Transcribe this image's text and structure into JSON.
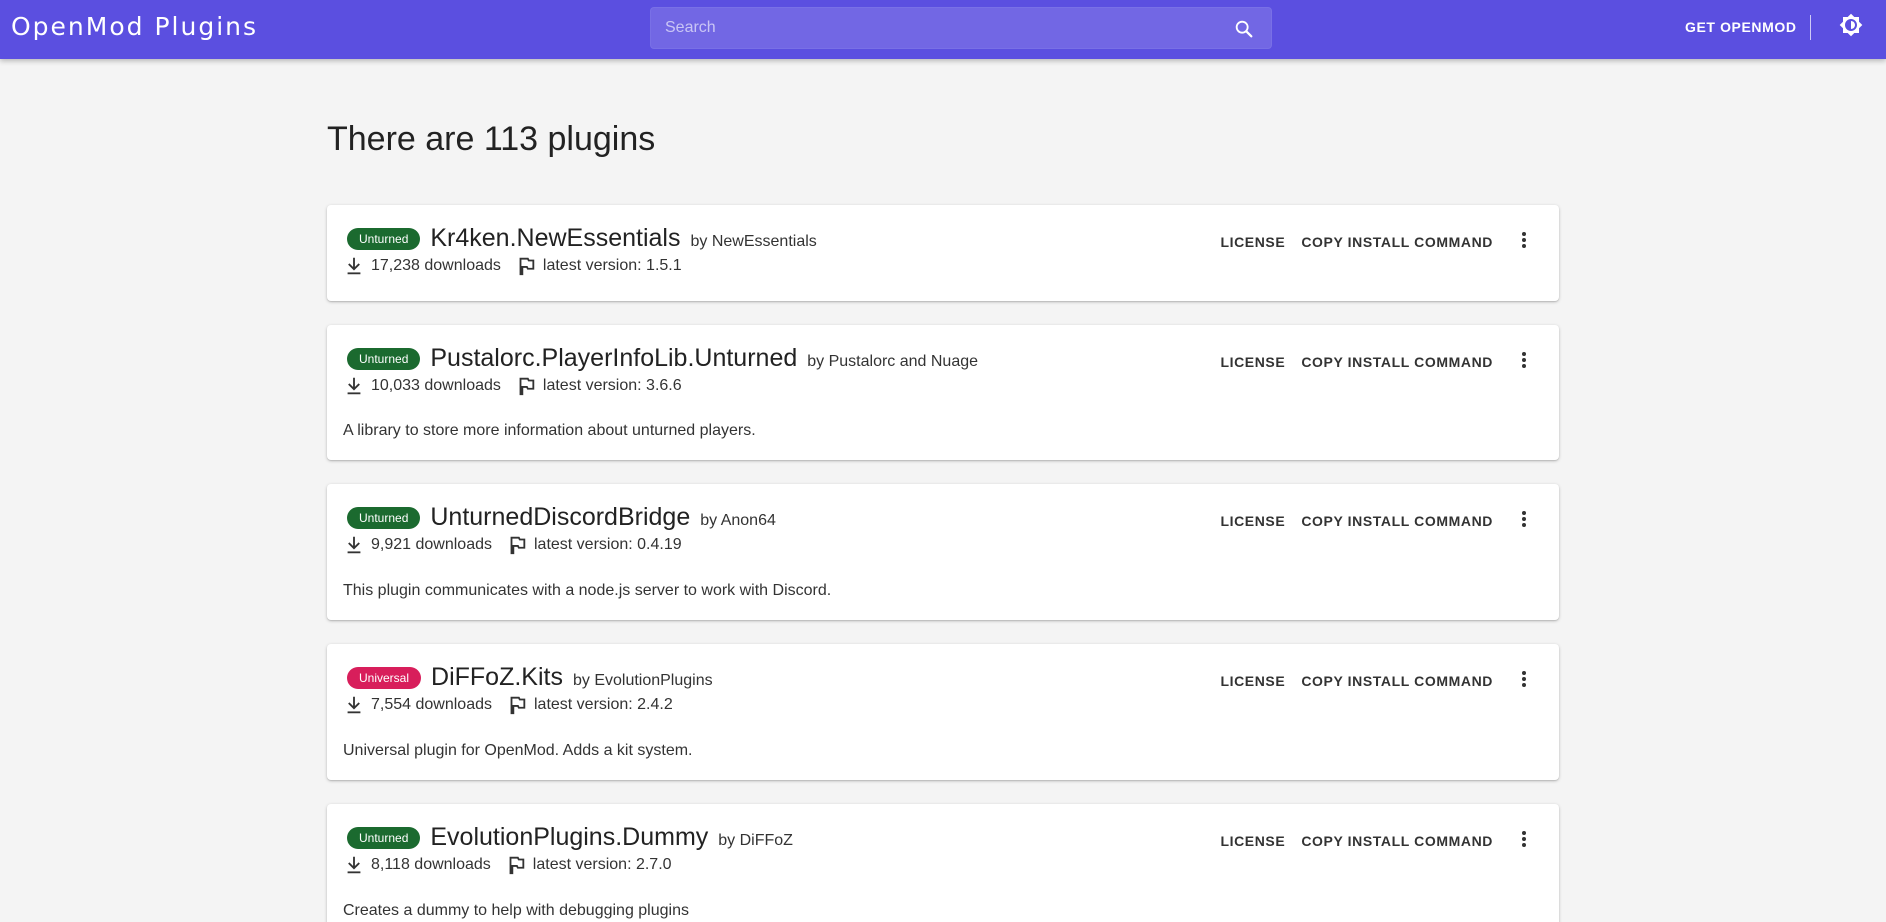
{
  "app": {
    "title": "OpenMod Plugins"
  },
  "search": {
    "placeholder": "Search",
    "icon": "search-icon"
  },
  "header": {
    "get_label": "GET OPENMOD",
    "theme_icon": "brightness-icon"
  },
  "heading": "There are 113 plugins",
  "colors": {
    "appbar": "#5b4fe0",
    "unturned_badge": "#1b6a2f",
    "universal_badge": "#d81e5b",
    "background": "#f4f4f4"
  },
  "actions": {
    "license": "LICENSE",
    "copy_install": "COPY INSTALL COMMAND"
  },
  "plugins": [
    {
      "badge": "Unturned",
      "name": "Kr4ken.NewEssentials",
      "author": "by NewEssentials",
      "downloads": "17,238 downloads",
      "version": "latest version: 1.5.1",
      "description": ""
    },
    {
      "badge": "Unturned",
      "name": "Pustalorc.PlayerInfoLib.Unturned",
      "author": "by Pustalorc and Nuage",
      "downloads": "10,033 downloads",
      "version": "latest version: 3.6.6",
      "description": "A library to store more information about unturned players."
    },
    {
      "badge": "Unturned",
      "name": "UnturnedDiscordBridge",
      "author": "by Anon64",
      "downloads": "9,921 downloads",
      "version": "latest version: 0.4.19",
      "description": "This plugin communicates with a node.js server to work with Discord."
    },
    {
      "badge": "Universal",
      "name": "DiFFoZ.Kits",
      "author": "by EvolutionPlugins",
      "downloads": "7,554 downloads",
      "version": "latest version: 2.4.2",
      "description": "Universal plugin for OpenMod. Adds a kit system."
    },
    {
      "badge": "Unturned",
      "name": "EvolutionPlugins.Dummy",
      "author": "by DiFFoZ",
      "downloads": "8,118 downloads",
      "version": "latest version: 2.7.0",
      "description": "Creates a dummy to help with debugging plugins"
    }
  ]
}
